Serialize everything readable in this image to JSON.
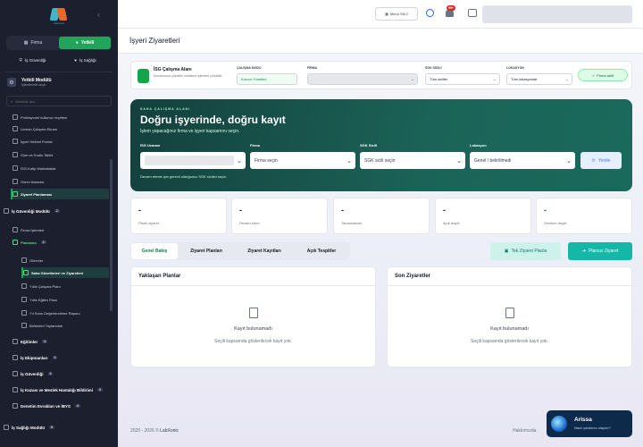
{
  "sidebar": {
    "logo_text": "Labxonic",
    "toggle": {
      "firma": "Firma",
      "yetkili": "Yetkili"
    },
    "subtabs": {
      "is_guvenligi": "İş Güvenliği",
      "is_sagligi": "İş Sağlığı"
    },
    "module": {
      "title": "Yetkili Modülü",
      "subtitle": "İşlemlerinizi seçin"
    },
    "search_placeholder": "Menüde ara...",
    "items": [
      {
        "label": "Profesyonel kullanıcı reçetesi"
      },
      {
        "label": "Uzman Çalışma Ekranı"
      },
      {
        "label": "İşyeri Hekimi Portalı"
      },
      {
        "label": "Süre ve Kodlu Takibi"
      },
      {
        "label": "İSG-Katip Muhtabakat"
      },
      {
        "label": "Görev Ataması"
      },
      {
        "label": "Ziyaret Planlaması"
      },
      {
        "label": "İş Güvenliği Modülü",
        "count": "2"
      },
      {
        "label": "Firma İşlemleri"
      },
      {
        "label": "Planlama",
        "count": "2"
      },
      {
        "label": "Görevler"
      },
      {
        "label": "Saha Gözetimleri ve Ziyaretleri"
      },
      {
        "label": "Yıllık Çalışma Planı"
      },
      {
        "label": "Yıllık Eğitim Planı"
      },
      {
        "label": "Yıl Sonu Değerlendirme Raporu"
      },
      {
        "label": "Bölümleri Toplantıları"
      },
      {
        "label": "Eğitimler",
        "count": "4"
      },
      {
        "label": "İş Ekipmanları",
        "count": "2"
      },
      {
        "label": "İş Güvenliği",
        "count": "3"
      },
      {
        "label": "İş Kazası ve Meslek Hastalığı Bildirimi",
        "count": "3"
      },
      {
        "label": "Denetim Evrakları ve İBYS",
        "count": "4"
      },
      {
        "label": "İş Sağlığı Modülü",
        "count": "6"
      }
    ]
  },
  "topbar": {
    "menu_btn": "Menü Stil 2",
    "notif_badge": "99+"
  },
  "page": {
    "title": "İşyeri Ziyaretleri"
  },
  "context_bar": {
    "title": "İSG Çalışma Alanı",
    "subtitle": "Kurumunuzu yönetim veriakme işlemleri yürütülür",
    "mode_label": "ÇALIŞMA MODU",
    "mode_value": "Kurum Yönetimi",
    "firma_label": "FİRMA",
    "sgk_label": "SGK SİCİLİ",
    "sgk_value": "Tüm siciller",
    "lokasyon_label": "LOKASYON",
    "lokasyon_value": "Tüm lokasyonlar",
    "firma_status": "Firma aktif"
  },
  "hero": {
    "kicker": "SAHA ÇALIŞMA ALANI",
    "title": "Doğru işyerinde, doğru kayıt",
    "subtitle": "İşlem yapacağınız firma ve işyeri kapsamını seçin.",
    "isg_label": "İSG Uzmanı",
    "firma_label": "Firma",
    "firma_value": "Firma seçin",
    "sgk_label": "SGK Sicili",
    "sgk_value": "SGK sicili seçin",
    "lokasyon_label": "Lokasyon",
    "lokasyon_value": "Genel / belirtilmedi",
    "refresh": "Yenile",
    "note": "Devam etmek için görevli olduğunuz SGK sicilini seçin."
  },
  "stats": [
    {
      "value": "-",
      "label": "Planlı ziyaret"
    },
    {
      "value": "-",
      "label": "Devam eden"
    },
    {
      "value": "-",
      "label": "Tamamlanan"
    },
    {
      "value": "-",
      "label": "Açık tespit"
    },
    {
      "value": "-",
      "label": "Geciken tespit"
    }
  ],
  "tabs": [
    "Genel Bakış",
    "Ziyaret Planları",
    "Ziyaret Kayıtları",
    "Açık Tespitler"
  ],
  "actions": {
    "one_plan": "Tek Ziyaret Planla",
    "unplanned": "Plansız Ziyaret"
  },
  "panels": [
    {
      "title": "Yaklaşan Planlar",
      "empty": "Kayıt bulunamadı",
      "hint": "Seçili kapsamda gösterilecek kayıt yok."
    },
    {
      "title": "Son Ziyaretler",
      "empty": "Kayıt bulunamadı",
      "hint": "Seçili kapsamda gösterilecek kayıt yok."
    }
  ],
  "footer": {
    "copyright": "2020 - 2026 ©",
    "brand": "LabXonic",
    "right": "Hakkımızda"
  },
  "chat": {
    "name": "Arissa",
    "message": "Nasıl yardımcı olayım?"
  }
}
